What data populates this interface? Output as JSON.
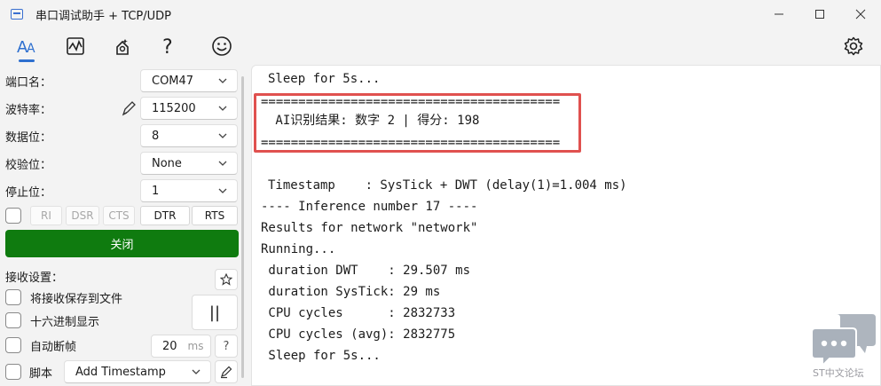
{
  "window": {
    "title": "串口调试助手 + TCP/UDP"
  },
  "toolbar": {
    "tools": [
      "font-icon",
      "chart-icon",
      "settings-brush-icon",
      "help-icon",
      "smile-icon",
      "gear-icon"
    ]
  },
  "serial": {
    "port_label": "端口名：",
    "port_value": "COM47",
    "baud_label": "波特率：",
    "baud_value": "115200",
    "databits_label": "数据位：",
    "databits_value": "8",
    "parity_label": "校验位：",
    "parity_value": "None",
    "stopbits_label": "停止位：",
    "stopbits_value": "1"
  },
  "pins": {
    "ri": "RI",
    "dsr": "DSR",
    "cts": "CTS",
    "dtr": "DTR",
    "rts": "RTS"
  },
  "open_button_label": "关闭",
  "receive": {
    "title": "接收设置：",
    "save_to_file": "将接收保存到文件",
    "hex_display": "十六进制显示",
    "auto_frame": "自动断帧",
    "frame_ms_value": "20",
    "frame_ms_unit": "ms",
    "help": "?",
    "script_label": "脚本",
    "script_value": "Add Timestamp",
    "pause": "||"
  },
  "terminal": {
    "lines": [
      "Sleep for 5s...",
      "========================================",
      " AI识别结果: 数字 2 | 得分: 198",
      "========================================",
      "",
      "Timestamp    : SysTick + DWT (delay(1)=1.004 ms)",
      "---- Inference number 17 ----",
      "Results for network \"network\"",
      "Running...",
      " duration DWT    : 29.507 ms",
      " duration SysTick: 29 ms",
      " CPU cycles      : 2832733",
      " CPU cycles (avg): 2832775",
      " Sleep for 5s..."
    ]
  },
  "watermark": {
    "text": "ST中文论坛"
  },
  "colors": {
    "accent": "#2d6fcf",
    "open_button": "#0f7b0f",
    "highlight_box": "#e0514f"
  }
}
